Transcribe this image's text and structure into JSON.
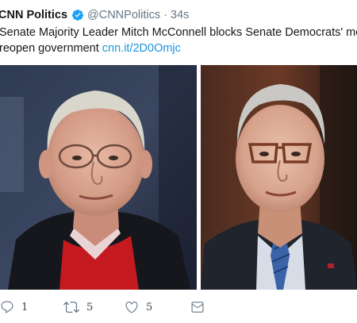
{
  "tweet": {
    "display_name": "CNN Politics",
    "handle": "@CNNPolitics",
    "separator": "·",
    "time": "34s",
    "text_line1": "Senate Majority Leader Mitch McConnell blocks Senate Democrats' move",
    "text_line2_prefix": "reopen government ",
    "link_text": "cnn.it/2D0Omjc"
  },
  "actions": {
    "reply_count": "1",
    "retweet_count": "5",
    "like_count": "5"
  },
  "icons": {
    "verified": "verified-badge-icon",
    "reply": "reply-icon",
    "retweet": "retweet-icon",
    "like": "heart-icon",
    "dm": "envelope-icon"
  },
  "colors": {
    "link": "#1b95e0",
    "verified": "#1da1f2",
    "muted": "#657786",
    "text": "#14171a"
  }
}
